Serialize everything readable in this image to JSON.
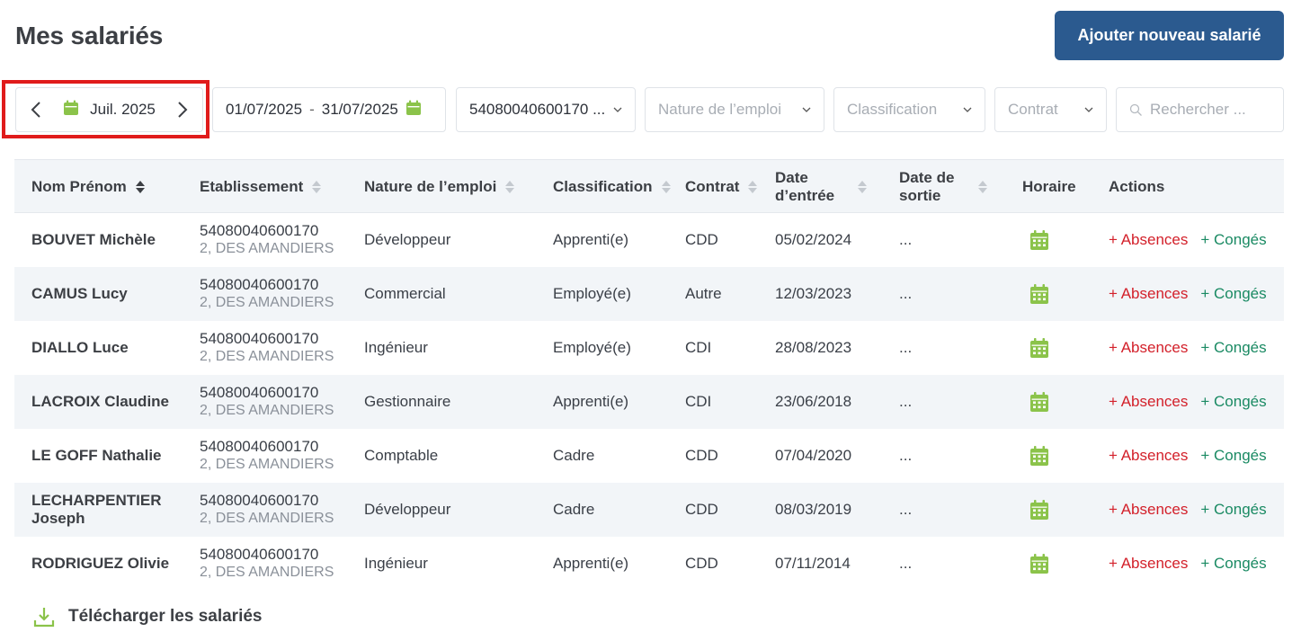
{
  "page": {
    "title": "Mes salariés"
  },
  "header": {
    "add_button_label": "Ajouter nouveau salarié"
  },
  "filters": {
    "month_label": "Juil. 2025",
    "date_start": "01/07/2025",
    "date_separator": "-",
    "date_end": "31/07/2025",
    "etablissement_value": "54080040600170 ...",
    "nature_placeholder": "Nature de l’emploi",
    "classification_placeholder": "Classification",
    "contrat_placeholder": "Contrat",
    "search_placeholder": "Rechercher ..."
  },
  "table": {
    "headers": {
      "nom": "Nom Prénom",
      "etablissement": "Etablissement",
      "nature": "Nature de l’emploi",
      "classification": "Classification",
      "contrat": "Contrat",
      "date_entree_1": "Date",
      "date_entree_2": "d’entrée",
      "date_sortie_1": "Date de",
      "date_sortie_2": "sortie",
      "horaire": "Horaire",
      "actions": "Actions"
    },
    "action_absences": "+ Absences",
    "action_conges": "+ Congés",
    "rows": [
      {
        "nom": "BOUVET Michèle",
        "etab_id": "54080040600170",
        "etab_addr": "2, DES AMANDIERS",
        "nature": "Développeur",
        "classification": "Apprenti(e)",
        "contrat": "CDD",
        "date_entree": "05/02/2024",
        "date_sortie": "..."
      },
      {
        "nom": "CAMUS Lucy",
        "etab_id": "54080040600170",
        "etab_addr": "2, DES AMANDIERS",
        "nature": "Commercial",
        "classification": "Employé(e)",
        "contrat": "Autre",
        "date_entree": "12/03/2023",
        "date_sortie": "..."
      },
      {
        "nom": "DIALLO Luce",
        "etab_id": "54080040600170",
        "etab_addr": "2, DES AMANDIERS",
        "nature": "Ingénieur",
        "classification": "Employé(e)",
        "contrat": "CDI",
        "date_entree": "28/08/2023",
        "date_sortie": "..."
      },
      {
        "nom": "LACROIX Claudine",
        "etab_id": "54080040600170",
        "etab_addr": "2, DES AMANDIERS",
        "nature": "Gestionnaire",
        "classification": "Apprenti(e)",
        "contrat": "CDI",
        "date_entree": "23/06/2018",
        "date_sortie": "..."
      },
      {
        "nom": "LE GOFF Nathalie",
        "etab_id": "54080040600170",
        "etab_addr": "2, DES AMANDIERS",
        "nature": "Comptable",
        "classification": "Cadre",
        "contrat": "CDD",
        "date_entree": "07/04/2020",
        "date_sortie": "..."
      },
      {
        "nom": "LECHARPENTIER Joseph",
        "etab_id": "54080040600170",
        "etab_addr": "2, DES AMANDIERS",
        "nature": "Développeur",
        "classification": "Cadre",
        "contrat": "CDD",
        "date_entree": "08/03/2019",
        "date_sortie": "..."
      },
      {
        "nom": "RODRIGUEZ Olivie",
        "etab_id": "54080040600170",
        "etab_addr": "2, DES AMANDIERS",
        "nature": "Ingénieur",
        "classification": "Apprenti(e)",
        "contrat": "CDD",
        "date_entree": "07/11/2014",
        "date_sortie": "..."
      }
    ]
  },
  "footer": {
    "download_label": "Télécharger les salariés"
  },
  "icons": {
    "calendar": "calendar-icon",
    "prev": "chevron-left-icon",
    "next": "chevron-right-icon",
    "dropdown": "chevron-down-icon",
    "search": "search-icon",
    "download": "download-icon"
  },
  "colors": {
    "primary": "#2b5a8f",
    "calendar_green": "#8bc34a",
    "absences_red": "#d3202a",
    "conges_green": "#1a8a63",
    "highlight_red": "#e01b1b"
  }
}
